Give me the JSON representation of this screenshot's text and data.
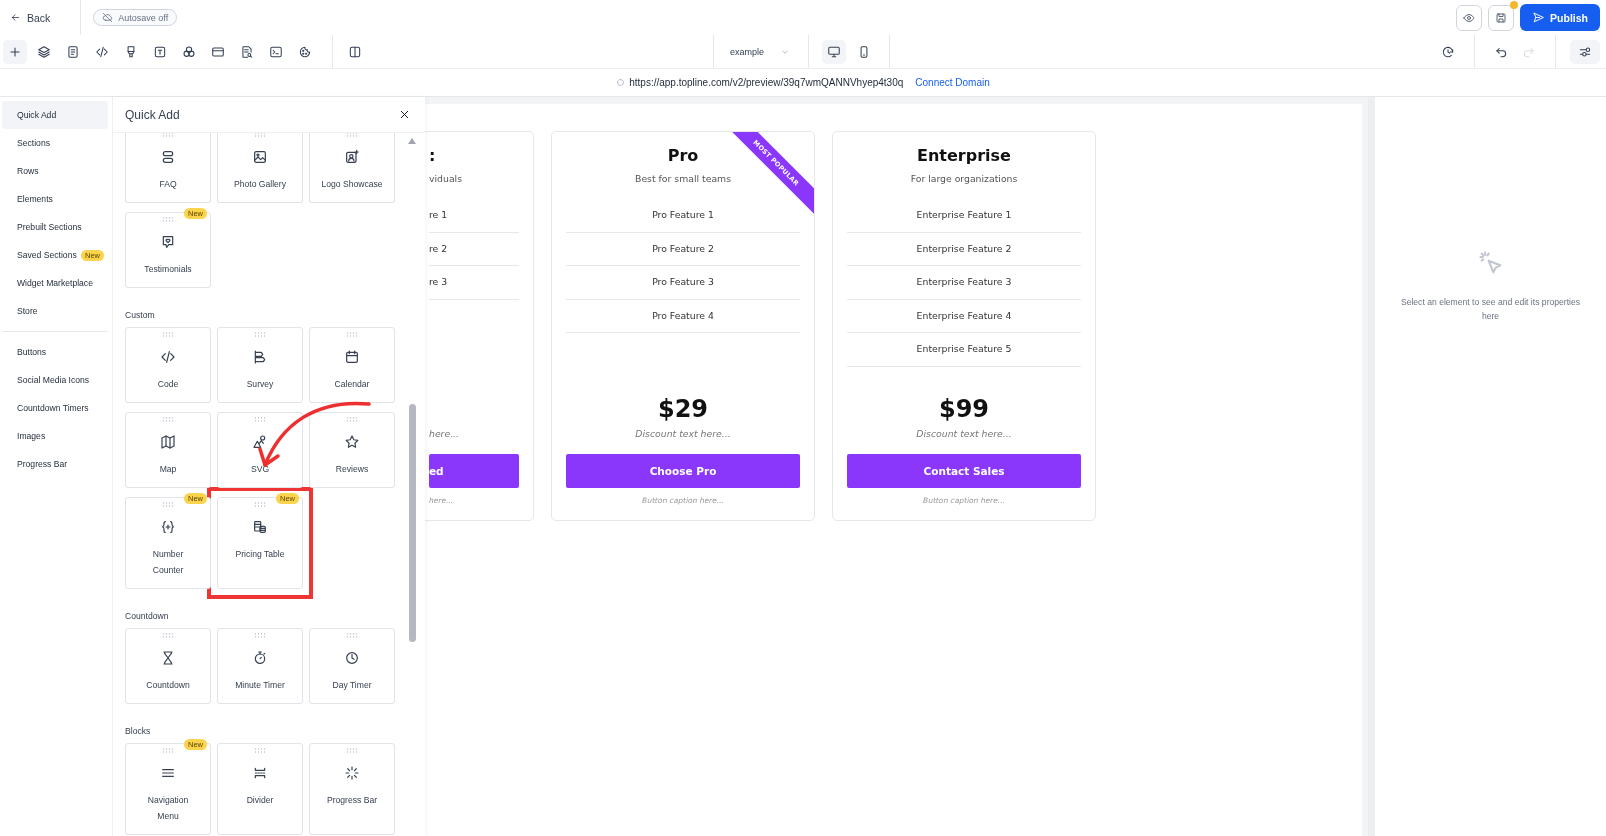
{
  "topbar": {
    "back": "Back",
    "autosave": "Autosave off",
    "actions": [
      {
        "kind": "preview",
        "unsaved": false
      },
      {
        "kind": "save",
        "unsaved": true
      }
    ],
    "publish": "Publish"
  },
  "toolbar": {
    "tools": [
      {
        "kind": "add",
        "selected": true
      },
      {
        "kind": "layers",
        "selected": false
      },
      {
        "kind": "page",
        "selected": false
      },
      {
        "kind": "code",
        "selected": false
      },
      {
        "kind": "brush",
        "selected": false
      },
      {
        "kind": "text",
        "selected": false
      },
      {
        "kind": "circles",
        "selected": false
      },
      {
        "kind": "layout",
        "selected": false
      },
      {
        "kind": "searchdoc",
        "selected": false
      },
      {
        "kind": "terminal",
        "selected": false
      },
      {
        "kind": "cookie",
        "selected": false
      },
      {
        "kind": "split",
        "selected": false
      }
    ],
    "page_select": "example",
    "devices": [
      {
        "kind": "desktop",
        "selected": true
      },
      {
        "kind": "mobile",
        "selected": false
      }
    ],
    "right_tools": [
      {
        "kind": "history",
        "disabled": false,
        "selected": false
      },
      {
        "kind": "undo",
        "disabled": false,
        "selected": false
      },
      {
        "kind": "redo",
        "disabled": true,
        "selected": false
      },
      {
        "kind": "settings",
        "disabled": false,
        "selected": true
      }
    ]
  },
  "url_bar": {
    "address": "https://app.topline.com/v2/preview/39q7wmQANNVhyep4t30q",
    "link": "Connect Domain"
  },
  "sidebar": {
    "groups": [
      [
        {
          "label": "Quick Add",
          "selected": true
        },
        {
          "label": "Sections",
          "selected": false
        },
        {
          "label": "Rows",
          "selected": false
        },
        {
          "label": "Elements",
          "selected": false
        },
        {
          "label": "Prebuilt Sections",
          "selected": false
        },
        {
          "label": "Saved Sections",
          "selected": false,
          "badge": "New"
        },
        {
          "label": "Widget Marketplace",
          "selected": false
        },
        {
          "label": "Store",
          "selected": false
        }
      ],
      [
        {
          "label": "Buttons",
          "selected": false
        },
        {
          "label": "Social Media Icons",
          "selected": false
        },
        {
          "label": "Countdown Timers",
          "selected": false
        },
        {
          "label": "Images",
          "selected": false
        },
        {
          "label": "Progress Bar",
          "selected": false
        }
      ]
    ]
  },
  "panel": {
    "title": "Quick Add",
    "pointer_arrow": true,
    "sections": [
      {
        "items": [
          {
            "label": "FAQ",
            "kind": "faq",
            "highlighted": false
          },
          {
            "label": "Photo Gallery",
            "kind": "image",
            "highlighted": false
          },
          {
            "label": "Logo Showcase",
            "kind": "logo",
            "highlighted": false
          },
          {
            "label": "Testimonials",
            "kind": "chat",
            "badge": "New",
            "highlighted": false
          }
        ]
      },
      {
        "heading": "Custom",
        "items": [
          {
            "label": "Code",
            "kind": "code",
            "highlighted": false
          },
          {
            "label": "Survey",
            "kind": "survey",
            "highlighted": false
          },
          {
            "label": "Calendar",
            "kind": "calendar",
            "highlighted": false
          },
          {
            "label": "Map",
            "kind": "map",
            "highlighted": false
          },
          {
            "label": "SVG",
            "kind": "shapes",
            "highlighted": false
          },
          {
            "label": "Reviews",
            "kind": "star",
            "highlighted": false
          },
          {
            "label": "Number Counter",
            "kind": "counter",
            "badge": "New",
            "highlighted": false
          },
          {
            "label": "Pricing Table",
            "kind": "coins",
            "badge": "New",
            "highlighted": true
          }
        ]
      },
      {
        "heading": "Countdown",
        "items": [
          {
            "label": "Countdown",
            "kind": "hourglass",
            "highlighted": false
          },
          {
            "label": "Minute Timer",
            "kind": "stopwatch",
            "highlighted": false
          },
          {
            "label": "Day Timer",
            "kind": "clock",
            "highlighted": false
          }
        ]
      },
      {
        "heading": "Blocks",
        "items": [
          {
            "label": "Navigation Menu",
            "kind": "menu",
            "badge": "New",
            "highlighted": false
          },
          {
            "label": "Divider",
            "kind": "divider",
            "highlighted": false
          },
          {
            "label": "Progress Bar",
            "kind": "spinner",
            "highlighted": false
          }
        ]
      }
    ]
  },
  "canvas": {
    "plans": [
      {
        "partial": true,
        "name": ":",
        "subtitle": "viduals",
        "features": [
          "re 1",
          "re 2",
          "re 3"
        ],
        "discount": "here...",
        "button": "ed",
        "caption": "here..."
      },
      {
        "partial": false,
        "name": "Pro",
        "subtitle": "Best for small teams",
        "ribbon": "MOST POPULAR",
        "features": [
          "Pro Feature 1",
          "Pro Feature 2",
          "Pro Feature 3",
          "Pro Feature 4"
        ],
        "price": "$29",
        "discount": "Discount text here...",
        "button": "Choose Pro",
        "caption": "Button caption here..."
      },
      {
        "partial": false,
        "name": "Enterprise",
        "subtitle": "For large organizations",
        "features": [
          "Enterprise Feature 1",
          "Enterprise Feature 2",
          "Enterprise Feature 3",
          "Enterprise Feature 4",
          "Enterprise Feature 5"
        ],
        "price": "$99",
        "discount": "Discount text here...",
        "button": "Contact Sales",
        "caption": "Button caption here..."
      }
    ]
  },
  "properties": {
    "hint": "Select an element to see and edit its properties here"
  }
}
